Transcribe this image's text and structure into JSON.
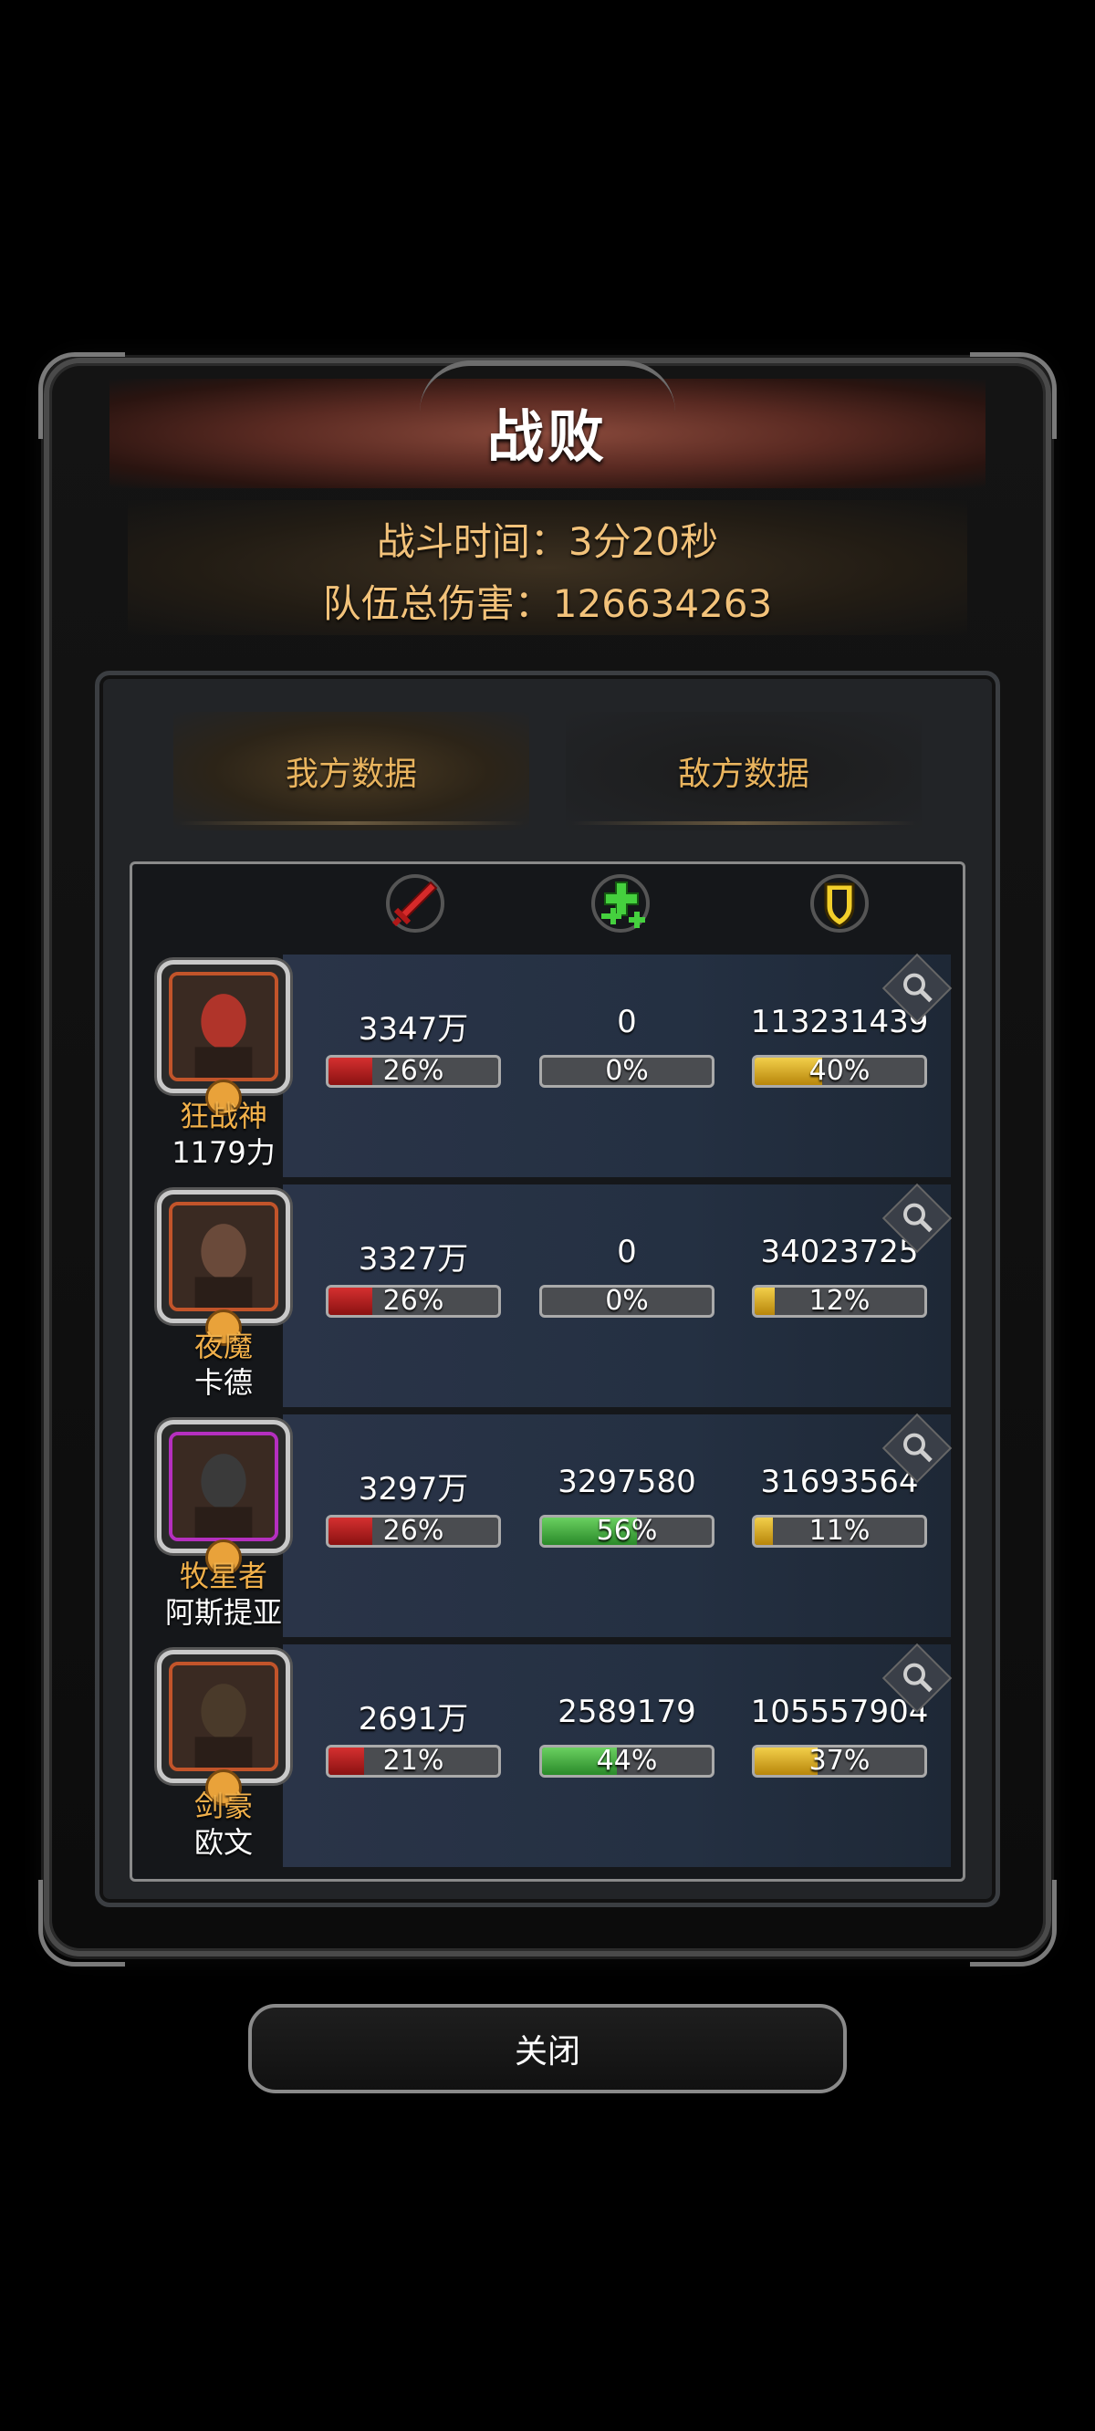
{
  "result_title": "战败",
  "battle_time": "战斗时间：3分20秒",
  "team_damage": "队伍总伤害：126634263",
  "tabs": {
    "mine": "我方数据",
    "enemy": "敌方数据"
  },
  "columns": [
    "sword-icon",
    "heal-cross-icon",
    "shield-icon"
  ],
  "heroes": [
    {
      "title": "狂战神",
      "name": "1179力",
      "frame": "orange",
      "damage": "3347万",
      "damage_pct": "26%",
      "damage_frac": 0.26,
      "heal": "0",
      "heal_pct": "0%",
      "heal_frac": 0,
      "tank": "113231439",
      "tank_pct": "40%",
      "tank_frac": 0.4
    },
    {
      "title": "夜魔",
      "name": "卡德",
      "frame": "orange",
      "damage": "3327万",
      "damage_pct": "26%",
      "damage_frac": 0.26,
      "heal": "0",
      "heal_pct": "0%",
      "heal_frac": 0,
      "tank": "34023725",
      "tank_pct": "12%",
      "tank_frac": 0.12
    },
    {
      "title": "牧星者",
      "name": "阿斯提亚",
      "frame": "purple",
      "damage": "3297万",
      "damage_pct": "26%",
      "damage_frac": 0.26,
      "heal": "3297580",
      "heal_pct": "56%",
      "heal_frac": 0.56,
      "tank": "31693564",
      "tank_pct": "11%",
      "tank_frac": 0.11
    },
    {
      "title": "剑豪",
      "name": "欧文",
      "frame": "orange",
      "damage": "2691万",
      "damage_pct": "21%",
      "damage_frac": 0.21,
      "heal": "2589179",
      "heal_pct": "44%",
      "heal_frac": 0.44,
      "tank": "105557904",
      "tank_pct": "37%",
      "tank_frac": 0.37
    }
  ],
  "close_label": "关闭",
  "colors": {
    "accent": "#f1b04a",
    "damage": "#c62020",
    "heal": "#4fbf45",
    "tank": "#e6b82e"
  }
}
